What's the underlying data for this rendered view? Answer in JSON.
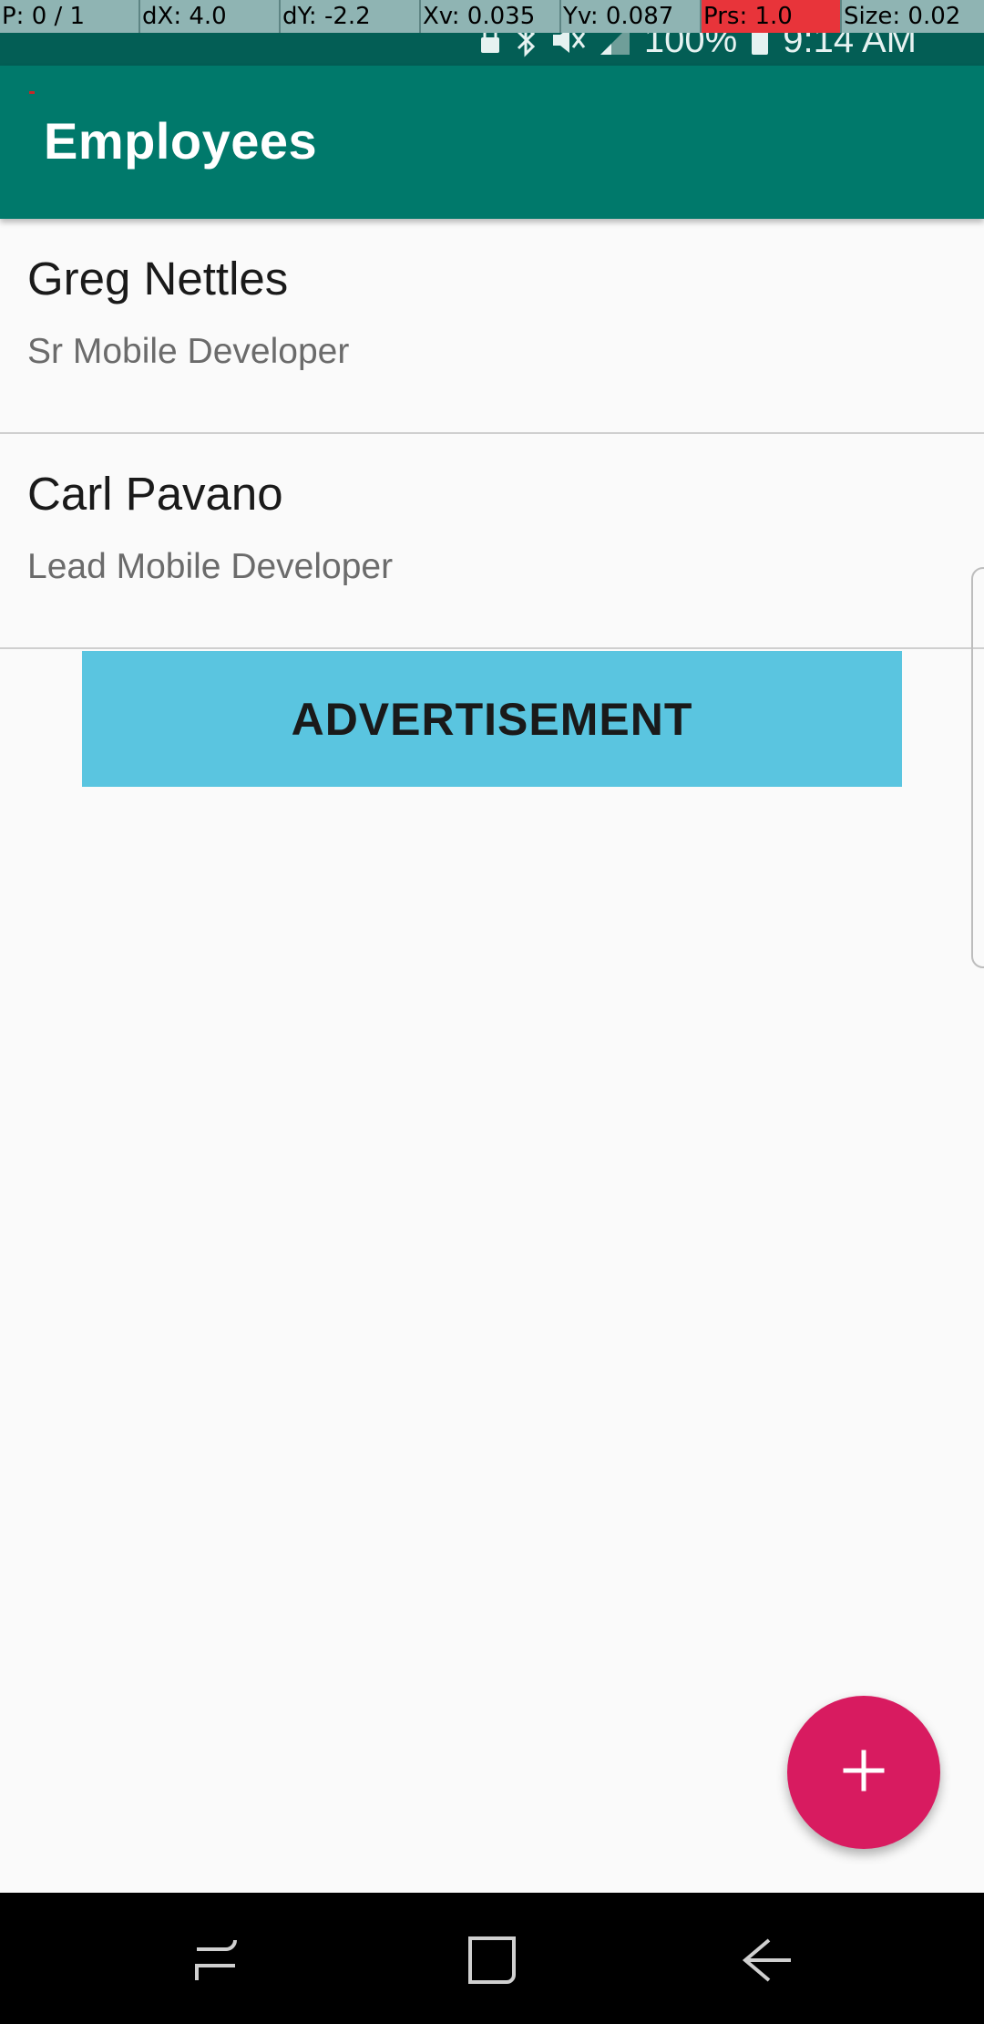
{
  "debug_overlay": {
    "pointer": "P: 0 / 1",
    "dx": "dX: 4.0",
    "dy": "dY: -2.2",
    "xv": "Xv: 0.035",
    "yv": "Yv: 0.087",
    "prs": "Prs: 1.0",
    "size": "Size: 0.02"
  },
  "status_bar": {
    "icons": [
      "lock-icon",
      "bluetooth-icon",
      "mute-icon",
      "signal-icon"
    ],
    "battery": "100%",
    "time": "9:14 AM"
  },
  "app_bar": {
    "title": "Employees"
  },
  "employees": [
    {
      "name": "Greg Nettles",
      "title": "Sr Mobile Developer"
    },
    {
      "name": "Carl Pavano",
      "title": "Lead Mobile Developer"
    }
  ],
  "ad": {
    "label": "ADVERTISEMENT"
  },
  "fab": {
    "icon": "plus-icon"
  },
  "nav": {
    "icons": [
      "recent-apps-icon",
      "home-icon",
      "back-icon"
    ]
  },
  "colors": {
    "primary_dark": "#035e55",
    "primary": "#00796b",
    "accent": "#d81b60",
    "ad_background": "#5ac5e0"
  }
}
